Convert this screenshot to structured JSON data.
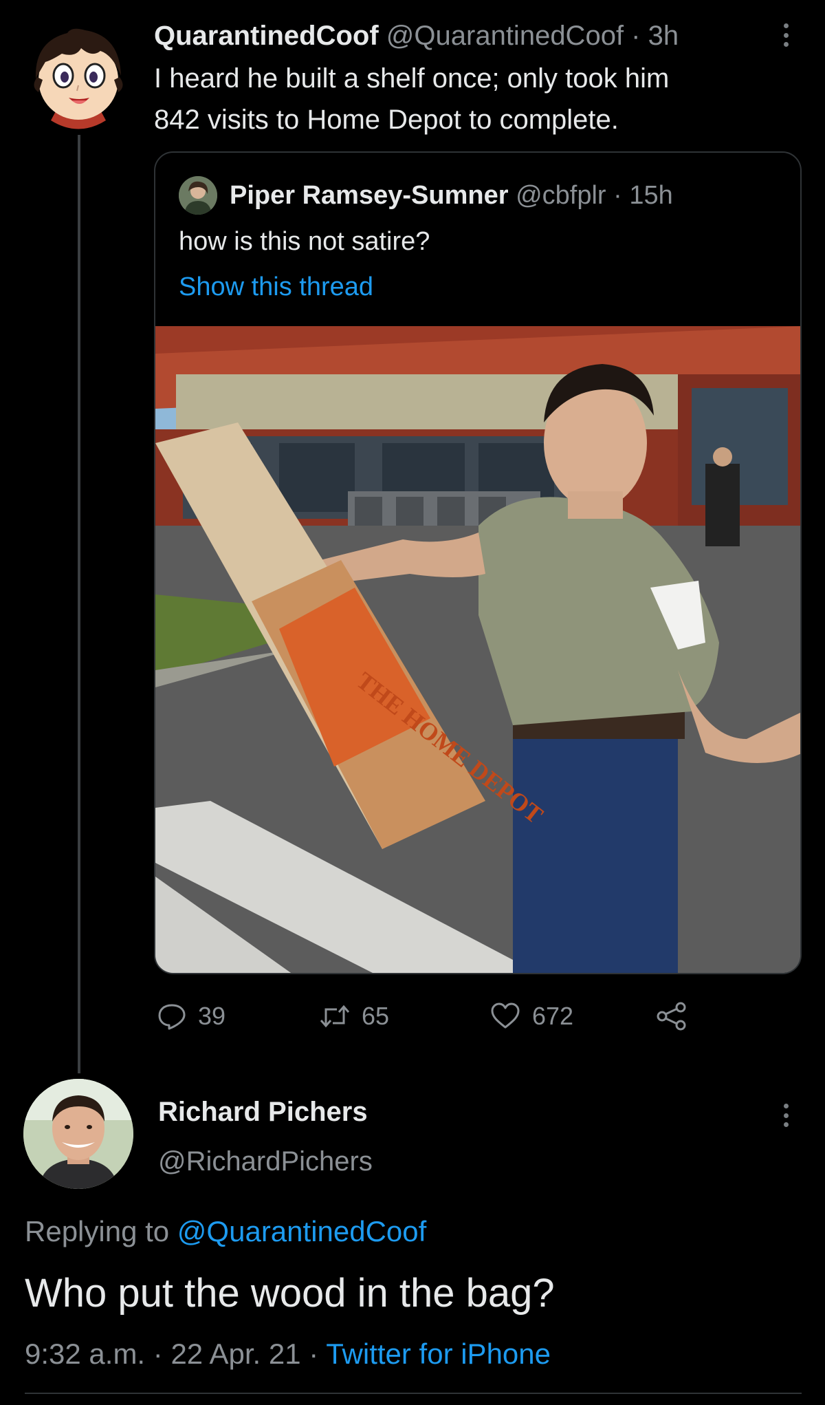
{
  "original_tweet": {
    "display_name": "QuarantinedCoof",
    "handle": "@QuarantinedCoof",
    "separator": " · ",
    "time": "3h",
    "text_lines": [
      "I heard he built a shelf once; only took him",
      "842 visits to Home Depot to complete."
    ],
    "quoted_tweet": {
      "display_name": "Piper Ramsey-Sumner",
      "handle": "@cbfplr",
      "separator": " · ",
      "time": "15h",
      "text": "how is this not satire?",
      "show_thread_label": "Show this thread",
      "media_bag_logo_text": "THE HOME DEPOT"
    },
    "actions": {
      "replies": "39",
      "retweets": "65",
      "likes": "672"
    }
  },
  "reply_tweet": {
    "display_name": "Richard Pichers",
    "handle": "@RichardPichers",
    "replying_prefix": "Replying to ",
    "replying_to": "@QuarantinedCoof",
    "text": "Who put the wood in the bag?",
    "time": "9:32 a.m.",
    "separator": " · ",
    "date": "22 Apr. 21",
    "source": "Twitter for iPhone"
  },
  "colors": {
    "background": "#000000",
    "text_primary": "#e7e9ea",
    "text_secondary": "#8b9095",
    "link": "#1d9bf0",
    "border": "#2f3336"
  },
  "icons": [
    "more-vertical-icon",
    "reply-icon",
    "retweet-icon",
    "like-icon",
    "share-icon"
  ]
}
